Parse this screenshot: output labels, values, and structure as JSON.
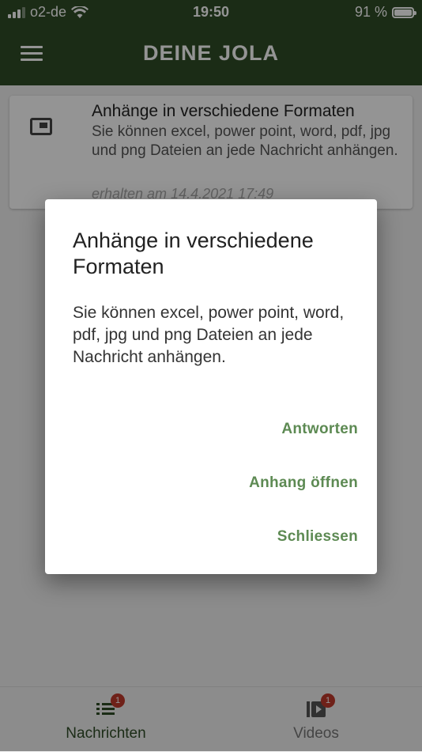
{
  "status_bar": {
    "carrier": "o2-de",
    "time": "19:50",
    "battery": "91 %",
    "battery_level": 0.91
  },
  "app_bar": {
    "title": "DEINE JOLA",
    "menu_icon": "hamburger-menu-icon"
  },
  "message_card": {
    "icon": "picture-in-picture-icon",
    "title": "Anhänge in verschiedene Formaten",
    "text": "Sie können excel, power point, word, pdf, jpg und png Dateien an jede Nachricht anhängen.",
    "date": "erhalten am 14.4.2021 17:49"
  },
  "dialog": {
    "title": "Anhänge in verschiedene Formaten",
    "body": "Sie können excel, power point, word, pdf, jpg und png Dateien an jede Nachricht anhängen.",
    "actions": {
      "reply": "Antworten",
      "open_attachment": "Anhang öffnen",
      "close": "Schliessen"
    }
  },
  "bottom_nav": {
    "messages": {
      "label": "Nachrichten",
      "badge": "1",
      "icon": "list-icon"
    },
    "videos": {
      "label": "Videos",
      "badge": "1",
      "icon": "video-library-icon"
    }
  },
  "colors": {
    "primary": "#2f4c27",
    "accent": "#5d8a53",
    "badge": "#c0392b"
  }
}
